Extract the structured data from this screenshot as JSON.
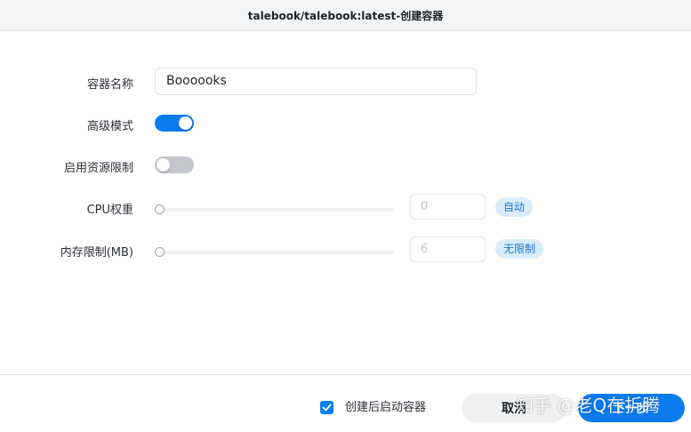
{
  "window": {
    "title": "talebook/talebook:latest-创建容器"
  },
  "form": {
    "container_name": {
      "label": "容器名称",
      "value": "Boooooks"
    },
    "advanced_mode": {
      "label": "高级模式",
      "enabled": true
    },
    "resource_limit": {
      "label": "启用资源限制",
      "enabled": false
    },
    "cpu_weight": {
      "label": "CPU权重",
      "value": "0",
      "tag": "自动",
      "level": 0
    },
    "memory_limit": {
      "label": "内存限制(MB)",
      "value": "6",
      "tag": "无限制",
      "level": 0
    }
  },
  "footer": {
    "start_after_create": {
      "label": "创建后启动容器",
      "checked": true
    },
    "cancel_label": "取消",
    "next_label": "下一步"
  },
  "watermark": "知乎 @老Q在折腾",
  "colors": {
    "accent": "#0a7cf0",
    "tag_bg": "#d9ecfb",
    "tag_text": "#1677d2"
  }
}
